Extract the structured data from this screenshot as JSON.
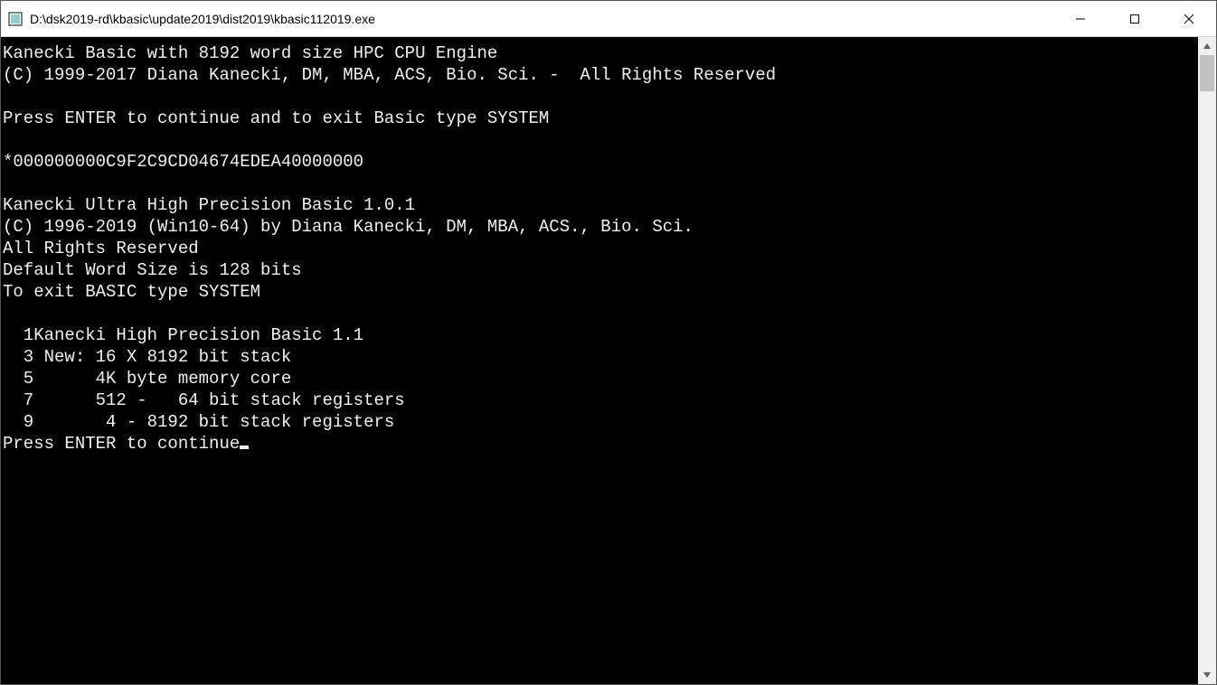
{
  "window": {
    "title": "D:\\dsk2019-rd\\kbasic\\update2019\\dist2019\\kbasic112019.exe"
  },
  "console": {
    "lines": [
      "Kanecki Basic with 8192 word size HPC CPU Engine",
      "(C) 1999-2017 Diana Kanecki, DM, MBA, ACS, Bio. Sci. -  All Rights Reserved",
      "",
      "Press ENTER to continue and to exit Basic type SYSTEM",
      "",
      "*000000000C9F2C9CD04674EDEA40000000",
      "",
      "Kanecki Ultra High Precision Basic 1.0.1",
      "(C) 1996-2019 (Win10-64) by Diana Kanecki, DM, MBA, ACS., Bio. Sci.",
      "All Rights Reserved",
      "Default Word Size is 128 bits",
      "To exit BASIC type SYSTEM",
      "",
      "  1Kanecki High Precision Basic 1.1",
      "  3 New: 16 X 8192 bit stack",
      "  5      4K byte memory core",
      "  7      512 -   64 bit stack registers",
      "  9       4 - 8192 bit stack registers"
    ],
    "prompt": "Press ENTER to continue"
  }
}
